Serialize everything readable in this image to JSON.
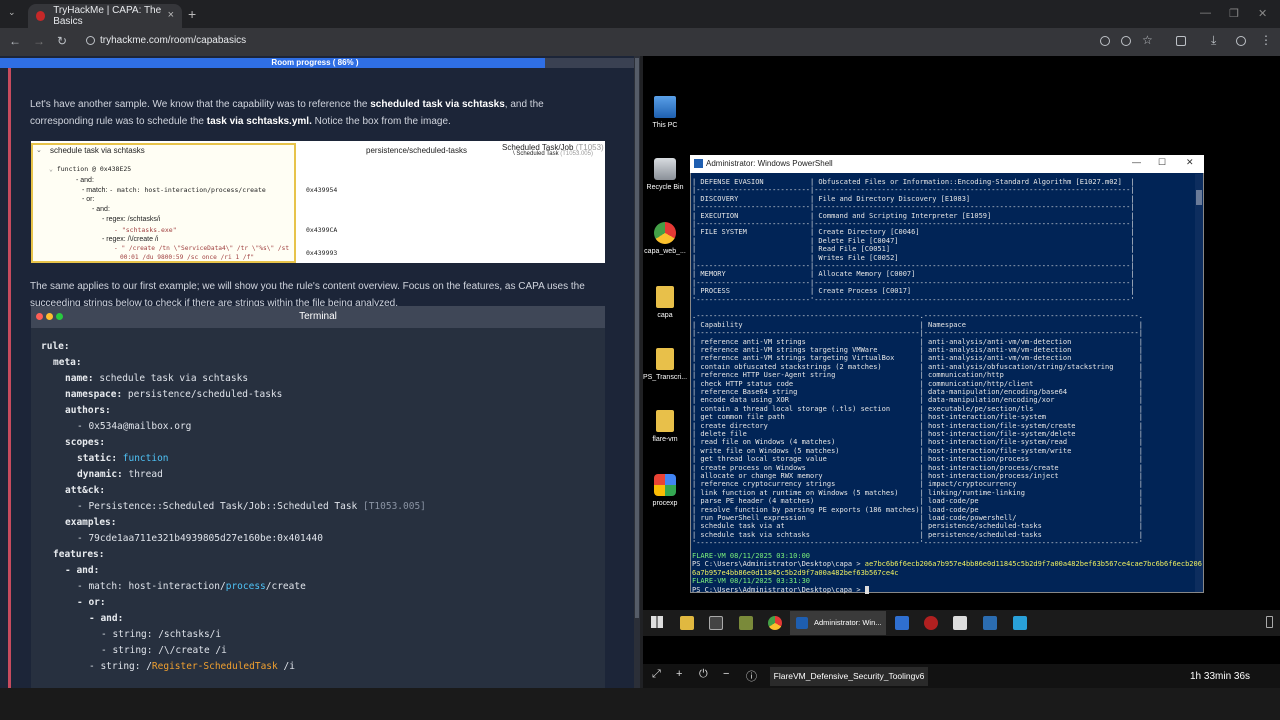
{
  "browser": {
    "tab_title": "TryHackMe | CAPA: The Basics",
    "url": "tryhackme.com/room/capabasics",
    "new_tab": "+",
    "tab_close": "×"
  },
  "room": {
    "progress_label": "Room progress ( 86% )",
    "progress": 0.86,
    "para1_a": "Let's have another sample.  We know that the capability was to reference the ",
    "para1_b": "scheduled task via schtasks",
    "para1_c": ", and the",
    "para1_d": "corresponding rule was to schedule the ",
    "para1_e": "task via schtasks.yml.",
    "para1_f": " Notice the box from the image.",
    "para2_a": "The same applies to our first example; we will show you the rule's content overview. Focus on the features, as CAPA uses the",
    "para2_b": "succeeding strings below to check if there are strings within the file being analyzed.",
    "image": {
      "rule_title": "schedule task via schtasks",
      "namespace": "persistence/scheduled-tasks",
      "attack_title": "Scheduled Task/Job",
      "attack_id": "(T1053)",
      "attack_sub": "\\ Scheduled Task",
      "attack_sub_id": "(T1053.005)",
      "lines": [
        "function @ 0x438E25",
        "- and:",
        "- match: host-interaction/process/create",
        "- or:",
        "- and:",
        "- regex: /schtasks/i",
        "- \"schtasks.exe\"",
        "- regex: /\\/create /i",
        "- \" /create /tn \\\"ServiceData4\\\" /tr \\\"%s\\\" /st",
        "00:01 /du 9800:59 /sc once /ri 1 /f\""
      ],
      "addresses": [
        "0x439954",
        "0x4399CA",
        "0x439993"
      ]
    },
    "terminal_title": "Terminal"
  },
  "terminal": {
    "l1": "rule:",
    "l2": "meta:",
    "l3a": "name: ",
    "l3b": "schedule task via schtasks",
    "l4a": "namespace: ",
    "l4b": "persistence/scheduled-tasks",
    "l5": "authors:",
    "l6": "- 0x534a@mailbox.org",
    "l7": "scopes:",
    "l8a": "static: ",
    "l8b": "function",
    "l9a": "dynamic: ",
    "l9b": "thread",
    "l10": "att&ck:",
    "l11a": "- Persistence::Scheduled Task/Job::Scheduled Task ",
    "l11b": "[T1053.005]",
    "l12": "examples:",
    "l13": "- 79cde1aa711e321b4939805d27e160be:0x401440",
    "l14": "features:",
    "l15": "- and:",
    "l16a": "- match: host-interaction/",
    "l16b": "process",
    "l16c": "/create",
    "l17": "- or:",
    "l18": "- and:",
    "l19": "- string: /schtasks/i",
    "l20": "- string: /\\/create /i",
    "l21a": "- string: /",
    "l21b": "Register-ScheduledTask",
    "l21c": " /i"
  },
  "desktop": {
    "icons": [
      {
        "label": "This PC"
      },
      {
        "label": "Recycle Bin"
      },
      {
        "label": "capa_web_..."
      },
      {
        "label": "capa"
      },
      {
        "label": "PS_Transcri..."
      },
      {
        "label": "flare-vm"
      },
      {
        "label": "procexp"
      }
    ]
  },
  "powershell": {
    "title": "Administrator: Windows PowerShell",
    "lines": [
      "| DEFENSE EVASION           | Obfuscated Files or Information::Encoding-Standard Algorithm [E1027.m02]  |",
      "|---------------------------|---------------------------------------------------------------------------|",
      "| DISCOVERY                 | File and Directory Discovery [E1083]                                      |",
      "|---------------------------|---------------------------------------------------------------------------|",
      "| EXECUTION                 | Command and Scripting Interpreter [E1059]                                 |",
      "|---------------------------|---------------------------------------------------------------------------|",
      "| FILE SYSTEM               | Create Directory [C0046]                                                  |",
      "|                           | Delete File [C0047]                                                       |",
      "|                           | Read File [C0051]                                                         |",
      "|                           | Writes File [C0052]                                                       |",
      "|---------------------------|---------------------------------------------------------------------------|",
      "| MEMORY                    | Allocate Memory [C0007]                                                   |",
      "|---------------------------|---------------------------------------------------------------------------|",
      "| PROCESS                   | Create Process [C0017]                                                    |",
      "'---------------------------'---------------------------------------------------------------------------'",
      "",
      ".-----------------------------------------------------.---------------------------------------------------.",
      "| Capability                                          | Namespace                                         |",
      "|-----------------------------------------------------|---------------------------------------------------|",
      "| reference anti-VM strings                           | anti-analysis/anti-vm/vm-detection                |",
      "| reference anti-VM strings targeting VMWare          | anti-analysis/anti-vm/vm-detection                |",
      "| reference anti-VM strings targeting VirtualBox      | anti-analysis/anti-vm/vm-detection                |",
      "| contain obfuscated stackstrings (2 matches)         | anti-analysis/obfuscation/string/stackstring      |",
      "| reference HTTP User-Agent string                    | communication/http                                |",
      "| check HTTP status code                              | communication/http/client                         |",
      "| reference Base64 string                             | data-manipulation/encoding/base64                 |",
      "| encode data using XOR                               | data-manipulation/encoding/xor                    |",
      "| contain a thread local storage (.tls) section       | executable/pe/section/tls                         |",
      "| get common file path                                | host-interaction/file-system                      |",
      "| create directory                                    | host-interaction/file-system/create               |",
      "| delete file                                         | host-interaction/file-system/delete               |",
      "| read file on Windows (4 matches)                    | host-interaction/file-system/read                 |",
      "| write file on Windows (5 matches)                   | host-interaction/file-system/write                |",
      "| get thread local storage value                      | host-interaction/process                          |",
      "| create process on Windows                           | host-interaction/process/create                   |",
      "| allocate or change RWX memory                       | host-interaction/process/inject                   |",
      "| reference cryptocurrency strings                    | impact/cryptocurrency                             |",
      "| link function at runtime on Windows (5 matches)     | linking/runtime-linking                           |",
      "| parse PE header (4 matches)                         | load-code/pe                                      |",
      "| resolve function by parsing PE exports (186 matches)| load-code/pe                                      |",
      "| run PowerShell expression                           | load-code/powershell/                             |",
      "| schedule task via at                                | persistence/scheduled-tasks                       |",
      "| schedule task via schtasks                          | persistence/scheduled-tasks                       |",
      "'-----------------------------------------------------'---------------------------------------------------'"
    ],
    "stamp1": "FLARE-VM 08/11/2025 03:10:00",
    "prompt1": "PS C:\\Users\\Administrator\\Desktop\\capa > ",
    "cmd1": "ae7bc6b6f6ecb206a7b957e4bb86e0d11845c5b2d9f7a00a482bef63b567ce4cae7bc6b6f6ecb206",
    "cmd1b": "6a7b957e4bb86e0d11845c5b2d9f7a00a482bef63b567ce4c",
    "stamp2": "FLARE-VM 08/11/2025 03:31:30",
    "prompt2": "PS C:\\Users\\Administrator\\Desktop\\capa > "
  },
  "taskbar": {
    "ps_label": "Administrator: Win..."
  },
  "vm": {
    "name": "FlareVM_Defensive_Security_Toolingv6",
    "time": "1h 33min 36s"
  }
}
